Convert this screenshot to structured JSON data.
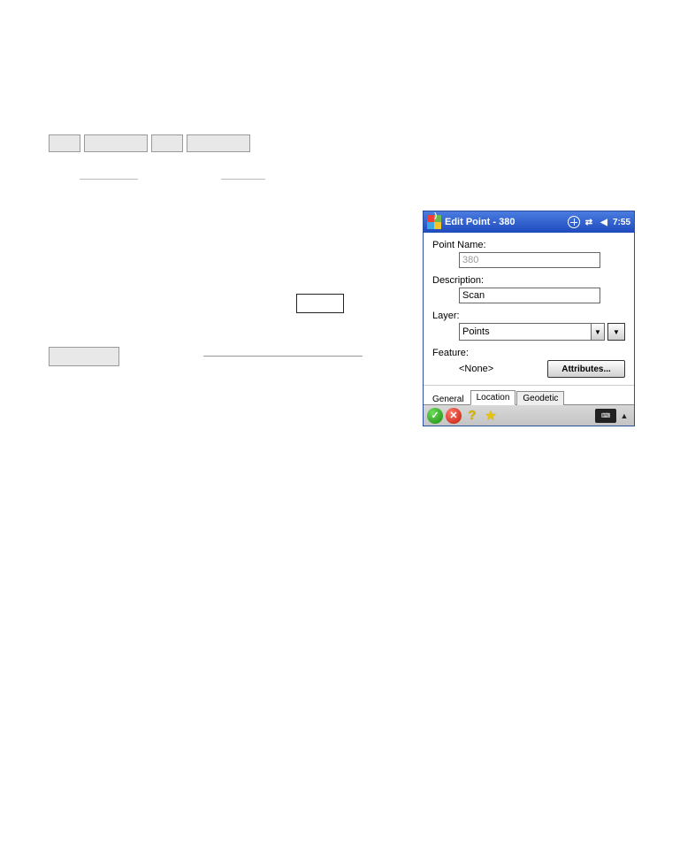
{
  "window": {
    "title": "Edit Point - 380",
    "time": "7:55"
  },
  "fields": {
    "point_name_label": "Point Name:",
    "point_name_value": "380",
    "description_label": "Description:",
    "description_value": "Scan",
    "layer_label": "Layer:",
    "layer_value": "Points",
    "feature_label": "Feature:",
    "feature_none": "<None>",
    "attributes_btn": "Attributes..."
  },
  "tabs": {
    "general": "General",
    "location": "Location",
    "geodetic": "Geodetic"
  },
  "toolbar": {
    "ok": "✓",
    "cancel": "✕",
    "help": "?",
    "star": "★",
    "kbd": "⌨",
    "up": "▲"
  }
}
